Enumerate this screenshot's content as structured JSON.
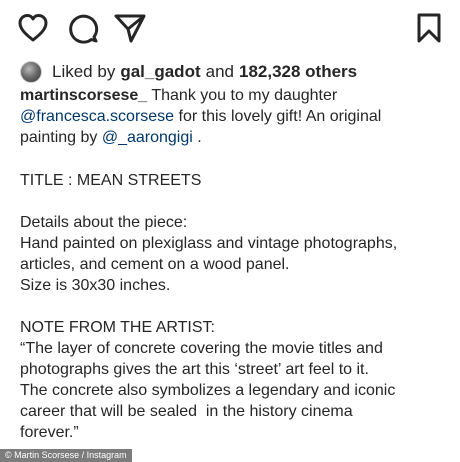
{
  "actions": {
    "icons": [
      "heart-icon",
      "comment-icon",
      "share-icon",
      "bookmark-icon"
    ]
  },
  "likes": {
    "prefix": "Liked by",
    "user": "gal_gadot",
    "connector": "and",
    "count": "182,328 others"
  },
  "caption": {
    "username": "martinscorsese_",
    "line1_text": "Thank you to my daughter",
    "mention1": "@francesca.scorsese",
    "line2_text": "for this lovely gift! An original",
    "line3_text": "painting by",
    "mention2": "@_aarongigi",
    "line3_end": ".",
    "title": "TITLE : MEAN STREETS",
    "details_heading": "Details about the piece:",
    "details_line1": "Hand painted on plexiglass and vintage photographs,",
    "details_line2": "articles, and cement on a wood panel.",
    "details_line3": "Size is 30x30 inches.",
    "note_heading": "NOTE FROM THE ARTIST:",
    "note_line1": "“The layer of concrete covering the movie titles and",
    "note_line2": "photographs gives the art this ‘street’ art feel to it.",
    "note_line3": "The concrete also symbolizes a legendary and iconic",
    "note_line4": "career that will be sealed  in the history cinema",
    "note_line5": "forever.”"
  },
  "credit": "© Martin Scorsese / Instagram",
  "colors": {
    "text": "#262626",
    "mention": "#00376b",
    "credit_bg": "#7c7c7c"
  }
}
